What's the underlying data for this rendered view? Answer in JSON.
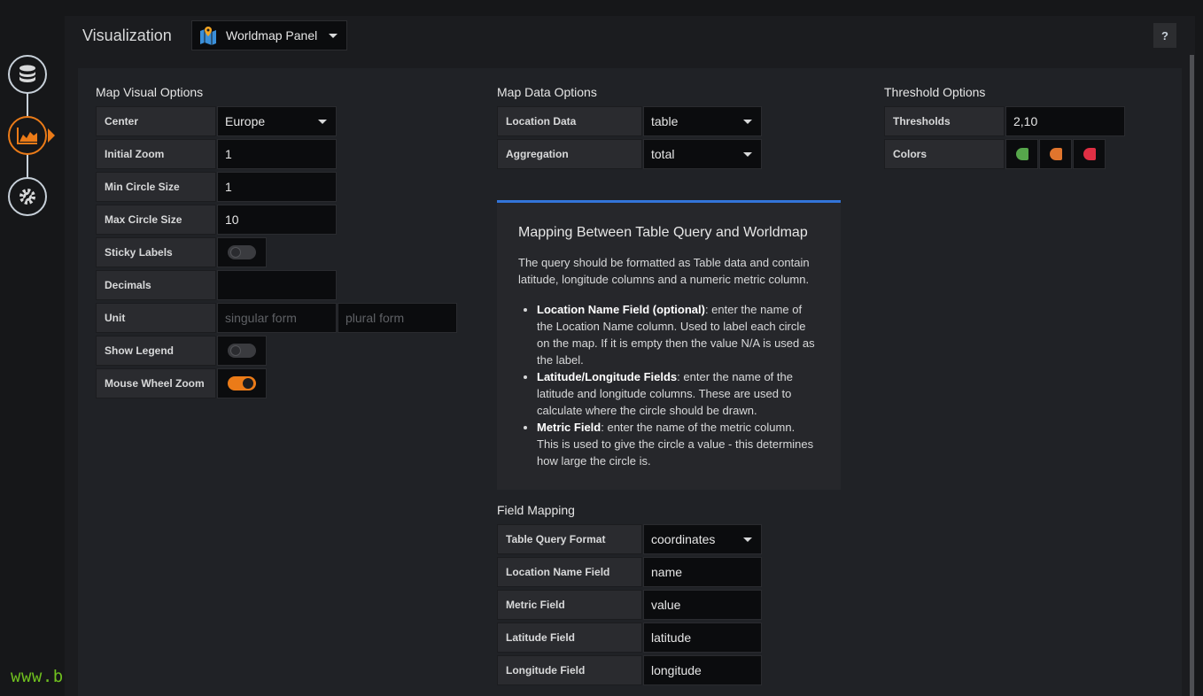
{
  "header": {
    "title": "Visualization",
    "visualization": "Worldmap Panel",
    "help_label": "?"
  },
  "map_visual_options": {
    "title": "Map Visual Options",
    "center": {
      "label": "Center",
      "value": "Europe"
    },
    "initial_zoom": {
      "label": "Initial Zoom",
      "value": "1"
    },
    "min_circle_size": {
      "label": "Min Circle Size",
      "value": "1"
    },
    "max_circle_size": {
      "label": "Max Circle Size",
      "value": "10"
    },
    "sticky_labels": {
      "label": "Sticky Labels",
      "on": false
    },
    "decimals": {
      "label": "Decimals",
      "value": ""
    },
    "unit": {
      "label": "Unit",
      "singular_placeholder": "singular form",
      "plural_placeholder": "plural form"
    },
    "show_legend": {
      "label": "Show Legend",
      "on": false
    },
    "mouse_wheel_zoom": {
      "label": "Mouse Wheel Zoom",
      "on": true
    }
  },
  "map_data_options": {
    "title": "Map Data Options",
    "location_data": {
      "label": "Location Data",
      "value": "table"
    },
    "aggregation": {
      "label": "Aggregation",
      "value": "total"
    }
  },
  "threshold_options": {
    "title": "Threshold Options",
    "thresholds": {
      "label": "Thresholds",
      "value": "2,10"
    },
    "colors": {
      "label": "Colors",
      "swatches": [
        "#56a64b",
        "#e0752d",
        "#e02f44"
      ]
    }
  },
  "info": {
    "title": "Mapping Between Table Query and Worldmap",
    "intro": "The query should be formatted as Table data and contain latitude, longitude columns and a numeric metric column.",
    "items": [
      {
        "term": "Location Name Field (optional)",
        "text": ": enter the name of the Location Name column. Used to label each circle on the map. If it is empty then the value N/A is used as the label."
      },
      {
        "term": "Latitude/Longitude Fields",
        "text": ": enter the name of the latitude and longitude columns. These are used to calculate where the circle should be drawn."
      },
      {
        "term": "Metric Field",
        "text": ": enter the name of the metric column. This is used to give the circle a value - this determines how large the circle is."
      }
    ]
  },
  "field_mapping": {
    "title": "Field Mapping",
    "table_query_format": {
      "label": "Table Query Format",
      "value": "coordinates"
    },
    "location_name_field": {
      "label": "Location Name Field",
      "value": "name"
    },
    "metric_field": {
      "label": "Metric Field",
      "value": "value"
    },
    "latitude_field": {
      "label": "Latitude Field",
      "value": "latitude"
    },
    "longitude_field": {
      "label": "Longitude Field",
      "value": "longitude"
    }
  },
  "watermark": "www.bujarra.com",
  "colors": {
    "accent": "#eb7b18",
    "info_border": "#3274d9"
  }
}
